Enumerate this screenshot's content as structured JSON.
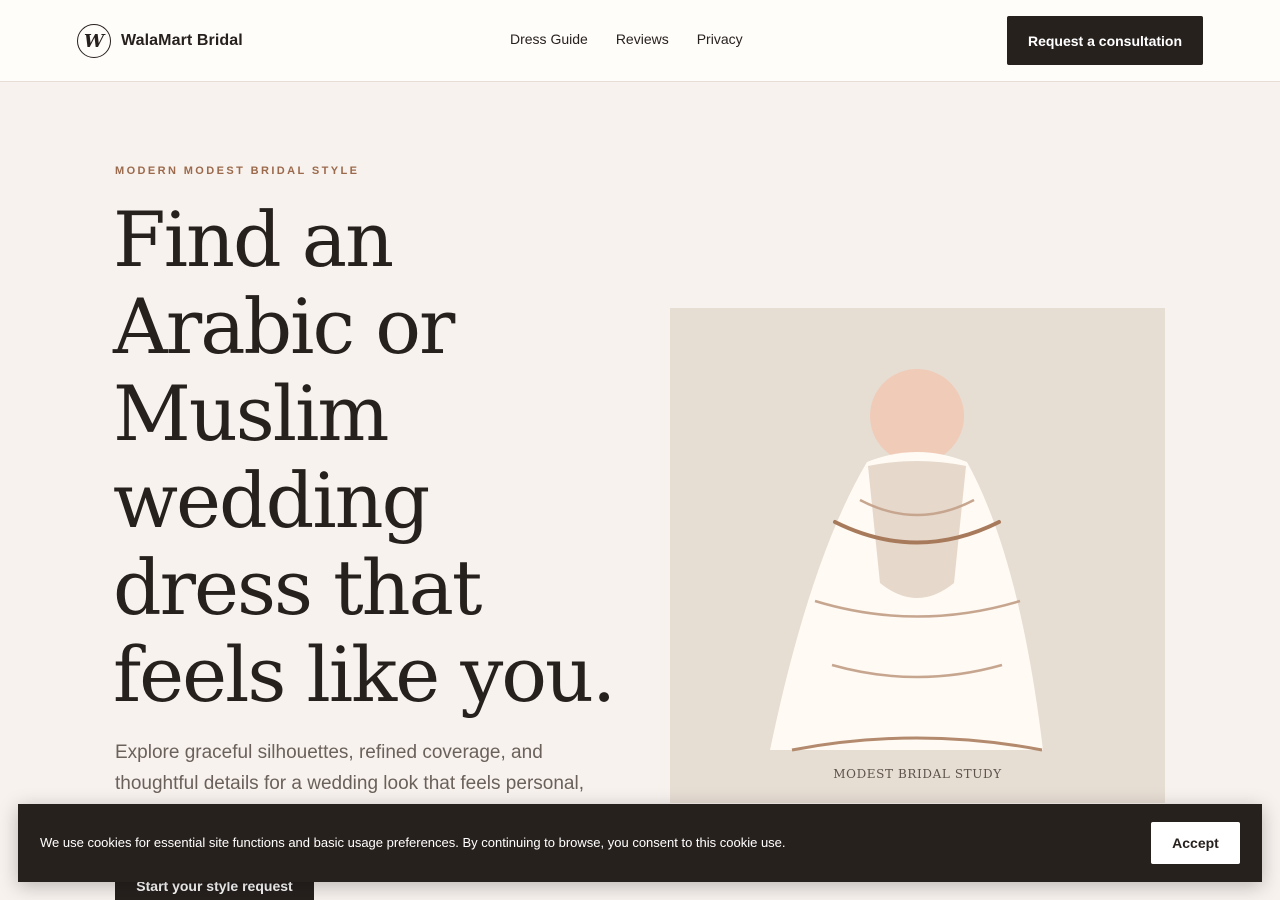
{
  "header": {
    "logo_letter": "W",
    "brand_name": "WalaMart Bridal",
    "nav": [
      "Dress Guide",
      "Reviews",
      "Privacy"
    ],
    "cta": "Request a consultation"
  },
  "hero": {
    "eyebrow": "MODERN MODEST BRIDAL STYLE",
    "headline": "Find an Arabic or Muslim wedding dress that feels like you.",
    "intro": "Explore graceful silhouettes, refined coverage, and thoughtful details for a wedding look that feels personal,",
    "cta": "Start your style request"
  },
  "illustration": {
    "caption": "MODEST BRIDAL STUDY"
  },
  "cookie": {
    "text": "We use cookies for essential site functions and basic usage preferences. By continuing to browse, you consent to this cookie use.",
    "accept": "Accept"
  },
  "colors": {
    "background": "#f8f2ee",
    "header_bg": "#fffdfa",
    "dark": "#27211e",
    "accent": "#9b6a4c",
    "illustration_bg": "#e6ddd3",
    "dress": "#fffaf3",
    "skin": "#f0cbb8"
  }
}
